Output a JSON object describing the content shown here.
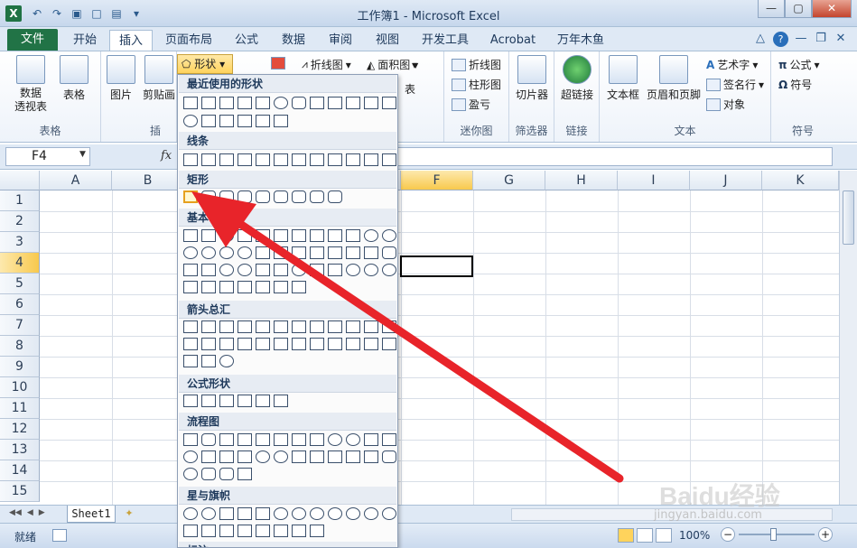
{
  "window": {
    "title": "工作簿1 - Microsoft Excel",
    "app_icon_label": "X"
  },
  "tabs": {
    "file": "文件",
    "items": [
      "开始",
      "插入",
      "页面布局",
      "公式",
      "数据",
      "审阅",
      "视图",
      "开发工具",
      "Acrobat",
      "万年木鱼"
    ],
    "active": "插入"
  },
  "ribbon": {
    "tables": {
      "pivot": "数据\n透视表",
      "table": "表格",
      "group_label": "表格"
    },
    "illustrations": {
      "picture": "图片",
      "clipart": "剪贴画",
      "shapes": "形状",
      "group_label": "插"
    },
    "charts": {
      "line": "折线图",
      "area": "面积图",
      "table_suffix": "表"
    },
    "sparklines": {
      "line": "折线图",
      "column": "柱形图",
      "winloss": "盈亏",
      "group_label": "迷你图"
    },
    "filter": {
      "slicer": "切片器",
      "group_label": "筛选器"
    },
    "links": {
      "hyperlink": "超链接",
      "group_label": "链接"
    },
    "text": {
      "textbox": "文本框",
      "header_footer": "页眉和页脚",
      "wordart": "艺术字",
      "signature": "签名行",
      "object": "对象",
      "group_label": "文本"
    },
    "symbols": {
      "equation": "公式",
      "symbol": "符号",
      "group_label": "符号"
    }
  },
  "formula_bar": {
    "name_box": "F4",
    "fx_label": "fx"
  },
  "grid": {
    "columns": [
      "A",
      "B",
      "C",
      "D",
      "E",
      "F",
      "G",
      "H",
      "I",
      "J",
      "K"
    ],
    "rows": [
      "1",
      "2",
      "3",
      "4",
      "5",
      "6",
      "7",
      "8",
      "9",
      "10",
      "11",
      "12",
      "13",
      "14",
      "15"
    ],
    "selected_column": "F",
    "selected_row": "4"
  },
  "sheet": {
    "tab": "Sheet1"
  },
  "status": {
    "ready": "就绪",
    "zoom": "100%"
  },
  "shapes_menu": {
    "categories": [
      "最近使用的形状",
      "线条",
      "矩形",
      "基本形状",
      "箭头总汇",
      "公式形状",
      "流程图",
      "星与旗帜",
      "标注"
    ],
    "basic_visible_label": "基本"
  },
  "watermark": {
    "brand": "Baidu经验",
    "url": "jingyan.baidu.com"
  },
  "colors": {
    "annotation_arrow": "#e8242a",
    "file_tab": "#217346",
    "selection_highlight": "#f8c94d"
  }
}
